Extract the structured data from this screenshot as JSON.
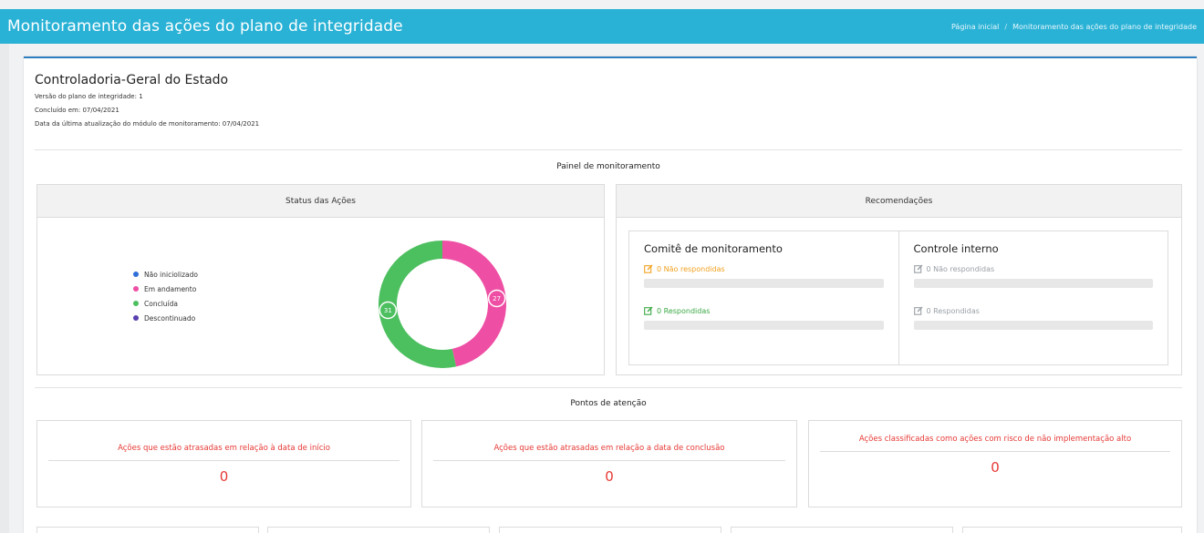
{
  "header": {
    "title": "Monitoramento das ações do plano de integridade",
    "breadcrumb": [
      "Página inicial",
      "Monitoramento das ações do plano de integridade"
    ]
  },
  "org": {
    "name": "Controladoria-Geral do Estado",
    "version": "Versão do plano de integridade: 1",
    "concluded": "Concluído em: 07/04/2021",
    "last_update": "Data da última atualização do módulo de monitoramento: 07/04/2021"
  },
  "painel": {
    "title": "Painel de monitoramento"
  },
  "status": {
    "title": "Status das Ações",
    "legend": [
      {
        "label": "Não iniciolizado",
        "color": "#2e6fd8"
      },
      {
        "label": "Em andamento",
        "color": "#ee4fa4"
      },
      {
        "label": "Concluída",
        "color": "#4cbf5f"
      },
      {
        "label": "Descontinuado",
        "color": "#5a3fb0"
      }
    ],
    "chart": {
      "slices": [
        {
          "label": "Em andamento",
          "value": 27,
          "color": "#ee4fa4"
        },
        {
          "label": "Concluída",
          "value": 31,
          "color": "#4cbf5f"
        }
      ]
    }
  },
  "recomendacoes": {
    "title": "Recomendações",
    "comite": {
      "title": "Comitê de monitoramento",
      "nao_resp": "0 Não respondidas",
      "resp": "0 Respondidas",
      "nao_color": "#f2a11f",
      "resp_color": "#3aa844"
    },
    "controle": {
      "title": "Controle interno",
      "nao_resp": "0 Não respondidas",
      "resp": "0 Respondidas",
      "color": "#9aa0a6"
    }
  },
  "pontos": {
    "title": "Pontos de atenção",
    "cards": [
      {
        "text": "Ações que estão atrasadas em relação à data de início",
        "value": "0"
      },
      {
        "text": "Ações que estão atrasadas em relação a data de conclusão",
        "value": "0"
      },
      {
        "text": "Ações classificadas como ações com risco de não implementação alto",
        "value": "0"
      }
    ]
  }
}
